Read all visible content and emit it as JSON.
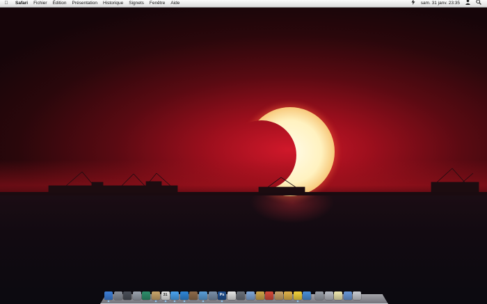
{
  "menubar": {
    "apple_icon": "apple-icon",
    "app_name": "Safari",
    "menus": [
      "Fichier",
      "Édition",
      "Présentation",
      "Historique",
      "Signets",
      "Fenêtre",
      "Aide"
    ],
    "status": {
      "clock": "sam. 31 janv. 23:35",
      "power_icon": "power-icon",
      "user_icon": "user-icon",
      "spotlight_icon": "search-icon"
    }
  },
  "wallpaper": {
    "subject": "annular solar eclipse over sea at sunset",
    "accent": "#c2121f"
  },
  "dock": {
    "icons": [
      {
        "name": "finder-icon",
        "color": "#3d7fd8",
        "running": true
      },
      {
        "name": "system-preferences-icon",
        "color": "#8a8f99",
        "running": false
      },
      {
        "name": "dashboard-icon",
        "color": "#4a4f58",
        "running": false
      },
      {
        "name": "automator-icon",
        "color": "#9aa2ad",
        "running": false
      },
      {
        "name": "time-machine-icon",
        "color": "#2e8f6c",
        "running": false
      },
      {
        "name": "preview-icon",
        "color": "#c9a66b",
        "running": true
      },
      {
        "name": "ical-icon",
        "color": "#e9e9e9",
        "label": "31",
        "running": true
      },
      {
        "name": "ichat-icon",
        "color": "#4aa3f0",
        "running": true
      },
      {
        "name": "safari-icon",
        "color": "#2f86d8",
        "running": true
      },
      {
        "name": "address-book-icon",
        "color": "#8e6b4a",
        "running": false
      },
      {
        "name": "itunes-icon",
        "color": "#5a9ed8",
        "running": true
      },
      {
        "name": "iphoto-icon",
        "color": "#7a8fa8",
        "running": false
      },
      {
        "name": "photoshop-icon",
        "color": "#1f4f8f",
        "label": "Ps",
        "running": true
      },
      {
        "name": "textedit-icon",
        "color": "#e6e6e6",
        "running": false
      },
      {
        "name": "script-editor-icon",
        "color": "#6a6f78",
        "running": false
      },
      {
        "name": "cube-icon",
        "color": "#7fa7d9",
        "running": false
      },
      {
        "name": "utility-icon",
        "color": "#cfa64a",
        "running": false
      },
      {
        "name": "photo-booth-icon",
        "color": "#d64a3a",
        "running": false
      },
      {
        "name": "garageband-icon",
        "color": "#c7a36a",
        "running": false
      },
      {
        "name": "imovie-icon",
        "color": "#e0b24a",
        "running": false
      },
      {
        "name": "pencil-icon",
        "color": "#f2d23c",
        "running": true
      },
      {
        "name": "network-icon",
        "color": "#4a8fd8",
        "running": false
      },
      {
        "name": "lock-icon",
        "color": "#9aa0a8",
        "gap": true,
        "running": false
      },
      {
        "name": "disk-utility-icon",
        "color": "#b8bcc4",
        "running": false
      },
      {
        "name": "lightbulb-icon",
        "color": "#f0e8b0",
        "running": false
      },
      {
        "name": "documents-stack-icon",
        "color": "#6a98d8",
        "running": false
      },
      {
        "name": "trash-icon",
        "color": "#c9ccd2",
        "running": false
      }
    ]
  }
}
